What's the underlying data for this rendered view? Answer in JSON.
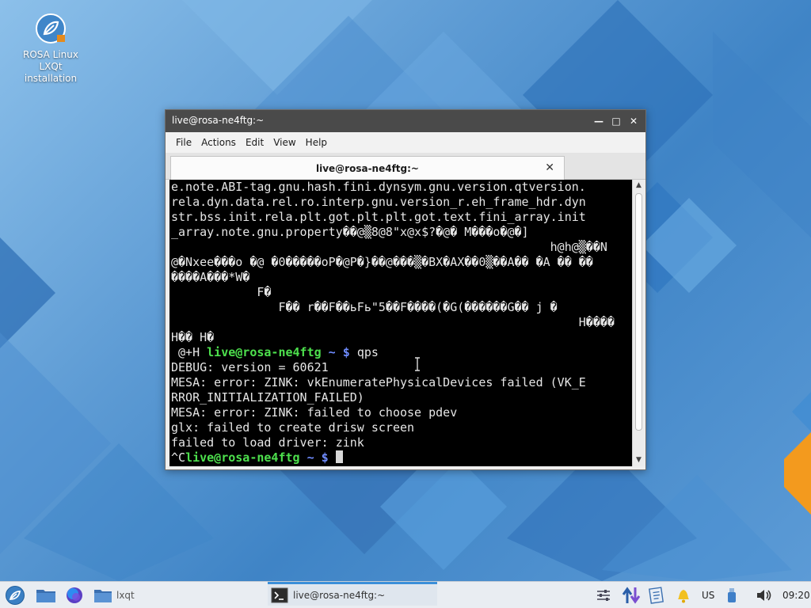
{
  "desktop": {
    "icon_label_lines": [
      "ROSA Linux",
      "LXQt",
      "installation"
    ]
  },
  "window": {
    "title": "live@rosa-ne4ftg:~",
    "controls": {
      "minimize": "—",
      "maximize": "□",
      "close": "✕"
    },
    "menu": [
      "File",
      "Actions",
      "Edit",
      "View",
      "Help"
    ],
    "tab": {
      "label": "live@rosa-ne4ftg:~",
      "close": "✕"
    }
  },
  "terminal": {
    "lines": [
      "e.note.ABI-tag.gnu.hash.fini.dynsym.gnu.version.qtversion.",
      "rela.dyn.data.rel.ro.interp.gnu.version_r.eh_frame_hdr.dyn",
      "str.bss.init.rela.plt.got.plt.plt.got.text.fini_array.init",
      "_array.note.gnu.property��@▒8@8\"x@x$?�@� M���o�@�]",
      "                                                     h@h@▒��N",
      "@�Nxee���o �@ �0�����oP�@P�}��@���▒�BX�AX��0▒��A�� �A �� ��",
      "����A���*W�",
      "            F�",
      "               F�� r��F��ьFь\"5��F����(�G(������G�� j �",
      "                                                         H����",
      "H�� H�"
    ],
    "prompt1": {
      "pre": " @+H ",
      "user": "live@rosa-ne4ftg",
      "path": " ~ $ ",
      "cmd": "qps"
    },
    "output": [
      "DEBUG: version = 60621",
      "MESA: error: ZINK: vkEnumeratePhysicalDevices failed (VK_E",
      "RROR_INITIALIZATION_FAILED)",
      "MESA: error: ZINK: failed to choose pdev",
      "glx: failed to create drisw screen",
      "failed to load driver: zink"
    ],
    "prompt2": {
      "pre": "^C",
      "user": "live@rosa-ne4ftg",
      "path": " ~ $ "
    }
  },
  "taskbar": {
    "folder_label": "lxqt",
    "active_task": "live@rosa-ne4ftg:~",
    "keyboard_layout": "US",
    "clock": "09:20"
  },
  "colors": {
    "prompt_user": "#4de04d",
    "prompt_path": "#6f8cff",
    "titlebar": "#4a4a4a",
    "taskbar_accent": "#3b8fd9"
  }
}
